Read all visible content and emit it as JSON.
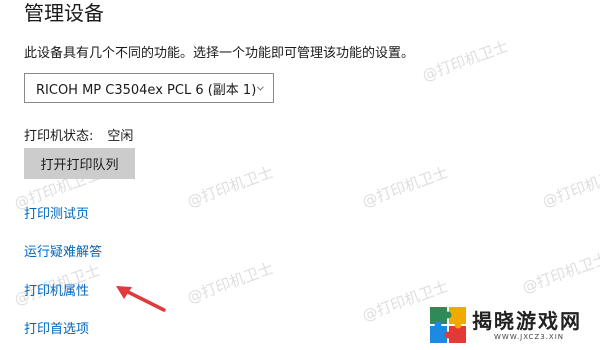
{
  "header": {
    "title": "管理设备"
  },
  "description": "此设备具有几个不同的功能。选择一个功能即可管理该功能的设置。",
  "device_select": {
    "selected": "RICOH MP C3504ex PCL 6 (副本 1)"
  },
  "status": {
    "label": "打印机状态:",
    "value": "空闲"
  },
  "actions": {
    "open_queue": "打开打印队列"
  },
  "links": [
    {
      "label": "打印测试页"
    },
    {
      "label": "运行疑难解答"
    },
    {
      "label": "打印机属性"
    },
    {
      "label": "打印首选项"
    }
  ],
  "watermark": {
    "text": "@打印机卫士"
  },
  "logo": {
    "brand": "揭晓游戏网",
    "url": "WWW.JXCZ3.XIN"
  },
  "colors": {
    "link": "#0067c0",
    "button_bg": "#cccccc",
    "arrow": "#e03a3e"
  }
}
